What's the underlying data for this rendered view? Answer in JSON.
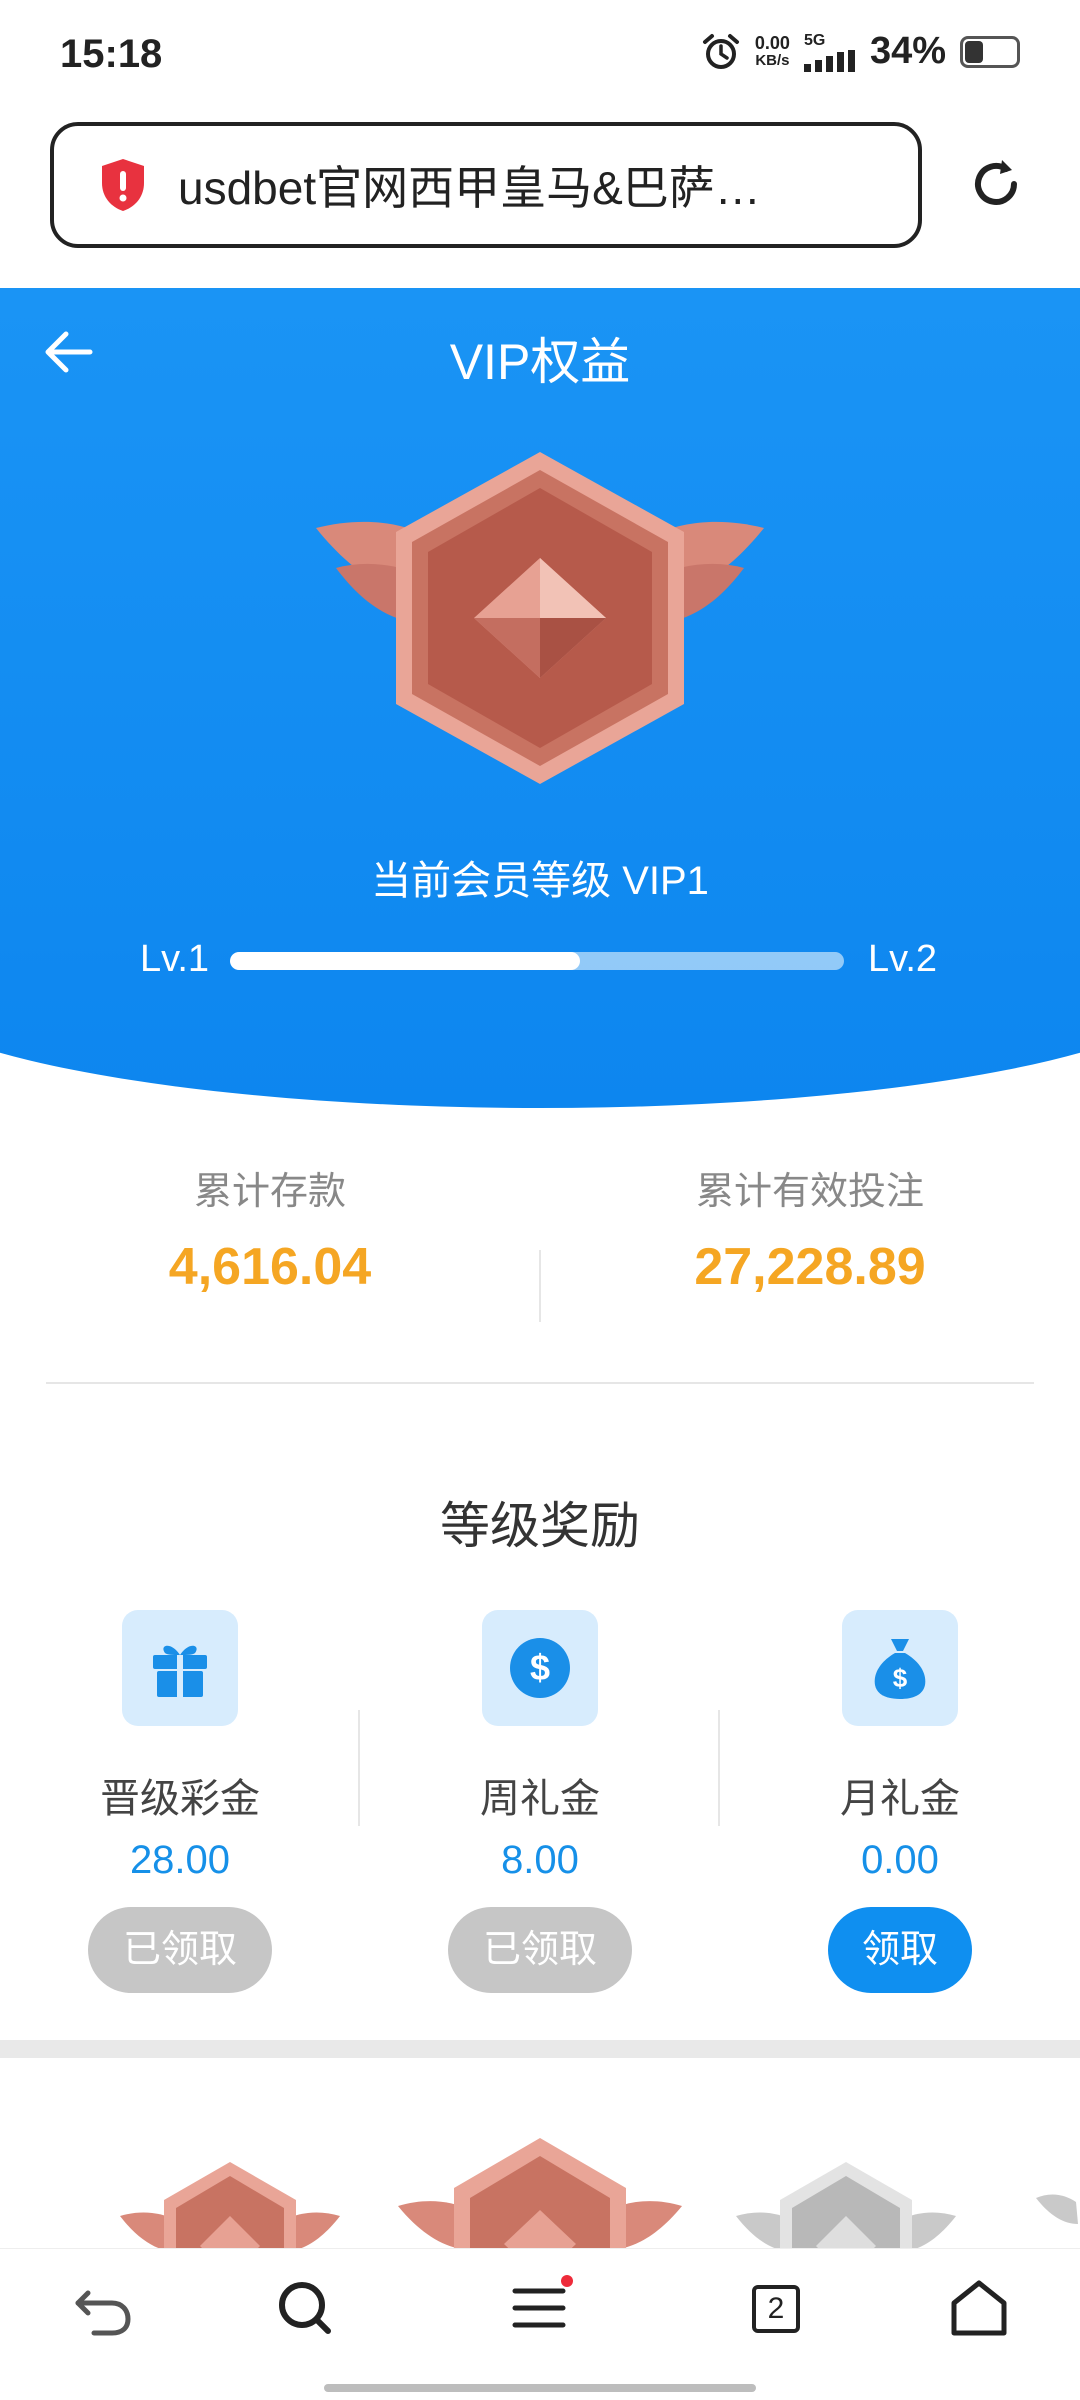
{
  "status_bar": {
    "time": "15:18",
    "speed_value": "0.00",
    "speed_unit": "KB/s",
    "network": "5G",
    "battery_pct": "34%",
    "battery_level": 0.34,
    "icons": [
      "alarm-icon",
      "signal-icon",
      "battery-icon"
    ]
  },
  "browser": {
    "url_text": "usdbet官网西甲皇马&巴萨…",
    "icons": [
      "shield-warning-icon",
      "reload-icon"
    ]
  },
  "header": {
    "title": "VIP权益",
    "back_icon": "back-arrow-icon"
  },
  "vip": {
    "current_level_text": "当前会员等级 VIP1",
    "level_from": "Lv.1",
    "level_to": "Lv.2",
    "progress": 0.57
  },
  "totals": {
    "deposit_label": "累计存款",
    "deposit_value": "4,616.04",
    "bet_label": "累计有效投注",
    "bet_value": "27,228.89"
  },
  "rewards": {
    "title": "等级奖励",
    "items": [
      {
        "label": "晋级彩金",
        "value": "28.00",
        "button": "已领取",
        "icon": "gift-icon",
        "claimed": true
      },
      {
        "label": "周礼金",
        "value": "8.00",
        "button": "已领取",
        "icon": "dollar-coin-icon",
        "claimed": true
      },
      {
        "label": "月礼金",
        "value": "0.00",
        "button": "领取",
        "icon": "money-bag-icon",
        "claimed": false
      }
    ]
  },
  "bottom_nav": {
    "tab_count": "2",
    "icons": [
      "back-icon",
      "search-icon",
      "menu-icon",
      "tabs-icon",
      "home-icon"
    ]
  },
  "colors": {
    "brand_blue": "#0f8ff0",
    "accent_orange": "#f5a623",
    "value_blue": "#1690e8",
    "claimed_gray": "#c6c6c6"
  }
}
